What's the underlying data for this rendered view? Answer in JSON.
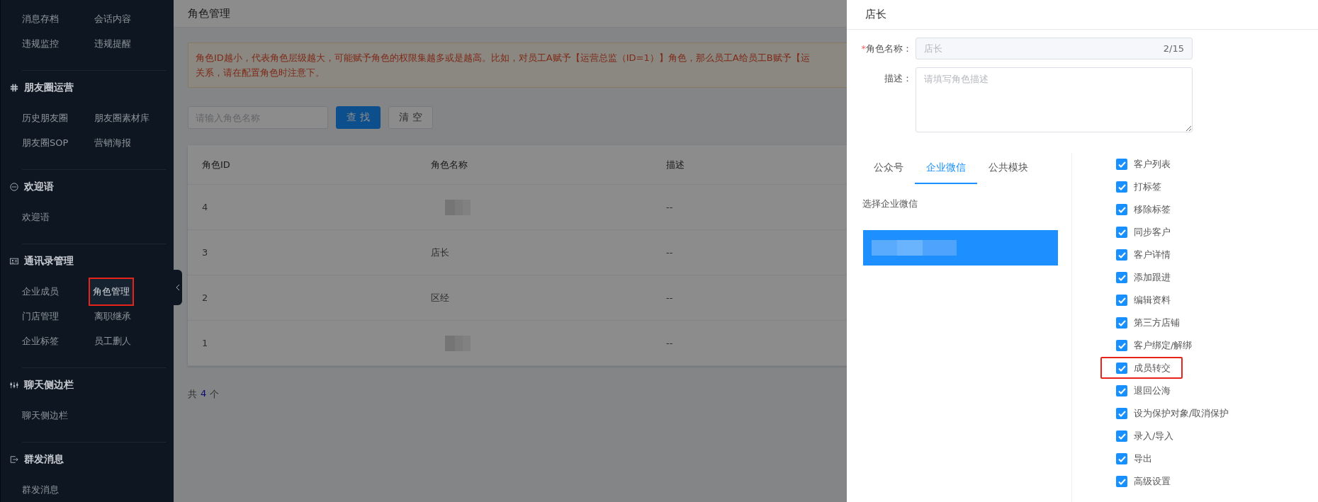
{
  "sidebar": {
    "sections": [
      {
        "items": [
          {
            "label": "消息存档",
            "selected": false
          },
          {
            "label": "会话内容",
            "selected": false
          },
          {
            "label": "违规监控",
            "selected": false
          },
          {
            "label": "违规提醒",
            "selected": false
          }
        ]
      },
      {
        "title": "朋友圈运营",
        "kind": "hash",
        "items": [
          {
            "label": "历史朋友圈",
            "selected": false
          },
          {
            "label": "朋友圈素材库",
            "selected": false
          },
          {
            "label": "朋友圈SOP",
            "selected": false
          },
          {
            "label": "营销海报",
            "selected": false
          }
        ]
      },
      {
        "title": "欢迎语",
        "kind": "chat",
        "items": [
          {
            "label": "欢迎语",
            "selected": false
          }
        ]
      },
      {
        "title": "通讯录管理",
        "kind": "card",
        "items": [
          {
            "label": "企业成员",
            "selected": false
          },
          {
            "label": "角色管理",
            "selected": true
          },
          {
            "label": "门店管理",
            "selected": false
          },
          {
            "label": "离职继承",
            "selected": false
          },
          {
            "label": "企业标签",
            "selected": false
          },
          {
            "label": "员工删人",
            "selected": false
          }
        ]
      },
      {
        "title": "聊天侧边栏",
        "kind": "sliders",
        "items": [
          {
            "label": "聊天侧边栏",
            "selected": false
          }
        ]
      },
      {
        "title": "群发消息",
        "kind": "exit",
        "items": [
          {
            "label": "群发消息",
            "selected": false
          }
        ]
      }
    ]
  },
  "page": {
    "title": "角色管理",
    "notice": {
      "line_1": "角色ID越小，代表角色层级越大，可能赋予角色的权限集越多或是越高。比如，对员工A赋予【运营总监（ID=1）】角色，那么员工A给员工B赋予【运",
      "line_2": "关系，请在配置角色时注意下。"
    },
    "search": {
      "placeholder": "请输入角色名称"
    },
    "buttons": [
      "查 找",
      "清 空"
    ],
    "table": {
      "columns": [
        "角色ID",
        "角色名称",
        "描述"
      ],
      "rows": [
        {
          "id": "4",
          "name_redacted": true,
          "description": "--"
        },
        {
          "id": "3",
          "name": "店长",
          "description": "--"
        },
        {
          "id": "2",
          "name": "区经",
          "description": "--"
        },
        {
          "id": "1",
          "name_redacted": true,
          "description": "--"
        }
      ]
    },
    "total": {
      "prefix": "共",
      "count": "4",
      "suffix": "个"
    }
  },
  "drawer": {
    "title": "店长",
    "name_field": {
      "label": "角色名称：",
      "required_mark": "*",
      "value": "店长",
      "counter": "2/15",
      "disabled": true
    },
    "description_field": {
      "label": "描述：",
      "placeholder": "请填写角色描述"
    },
    "tabs": [
      {
        "label": "公众号",
        "selected": false
      },
      {
        "label": "企业微信",
        "selected": true
      },
      {
        "label": "公共模块",
        "selected": false
      }
    ],
    "list_label": "选择企业微信",
    "accounts": [
      {
        "selected": true
      }
    ],
    "permissions": [
      {
        "label": "客户列表",
        "checked": true,
        "highlighted": false
      },
      {
        "label": "打标签",
        "checked": true,
        "highlighted": false
      },
      {
        "label": "移除标签",
        "checked": true,
        "highlighted": false
      },
      {
        "label": "同步客户",
        "checked": true,
        "highlighted": false
      },
      {
        "label": "客户详情",
        "checked": true,
        "highlighted": false
      },
      {
        "label": "添加跟进",
        "checked": true,
        "highlighted": false
      },
      {
        "label": "编辑资料",
        "checked": true,
        "highlighted": false
      },
      {
        "label": "第三方店铺",
        "checked": true,
        "highlighted": false
      },
      {
        "label": "客户绑定/解绑",
        "checked": true,
        "highlighted": false
      },
      {
        "label": "成员转交",
        "checked": true,
        "highlighted": true
      },
      {
        "label": "退回公海",
        "checked": true,
        "highlighted": false
      },
      {
        "label": "设为保护对象/取消保护",
        "checked": true,
        "highlighted": false
      },
      {
        "label": "录入/导入",
        "checked": true,
        "highlighted": false
      },
      {
        "label": "导出",
        "checked": true,
        "highlighted": false
      },
      {
        "label": "高级设置",
        "checked": true,
        "highlighted": false
      }
    ]
  }
}
